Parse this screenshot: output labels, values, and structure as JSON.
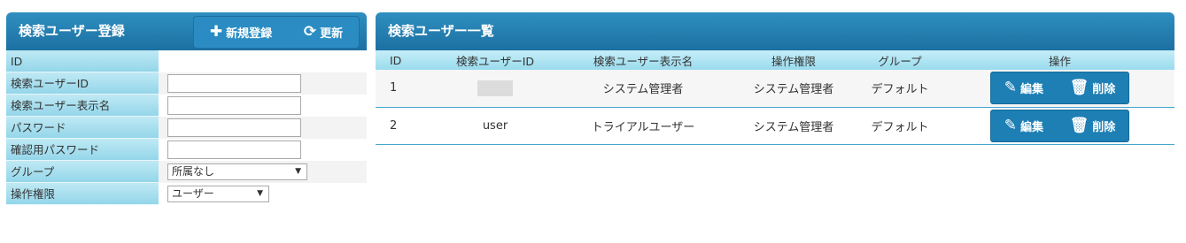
{
  "left": {
    "title": "検索ユーザー登録",
    "new_label": "新規登録",
    "refresh_label": "更新",
    "fields": [
      {
        "label": "ID",
        "type": "text"
      },
      {
        "label": "検索ユーザーID",
        "type": "input",
        "value": ""
      },
      {
        "label": "検索ユーザー表示名",
        "type": "input",
        "value": ""
      },
      {
        "label": "パスワード",
        "type": "input",
        "value": ""
      },
      {
        "label": "確認用パスワード",
        "type": "input",
        "value": ""
      },
      {
        "label": "グループ",
        "type": "select",
        "value": "所属なし"
      },
      {
        "label": "操作権限",
        "type": "select",
        "value": "ユーザー"
      }
    ]
  },
  "right": {
    "title": "検索ユーザー一覧",
    "columns": [
      "ID",
      "検索ユーザーID",
      "検索ユーザー表示名",
      "操作権限",
      "グループ",
      "操作"
    ],
    "rows": [
      {
        "id": "1",
        "user_id": "",
        "display_name": "システム管理者",
        "role": "システム管理者",
        "group": "デフォルト",
        "edit": "編集",
        "delete": "削除"
      },
      {
        "id": "2",
        "user_id": "user",
        "display_name": "トライアルユーザー",
        "role": "システム管理者",
        "group": "デフォルト",
        "edit": "編集",
        "delete": "削除"
      }
    ]
  }
}
